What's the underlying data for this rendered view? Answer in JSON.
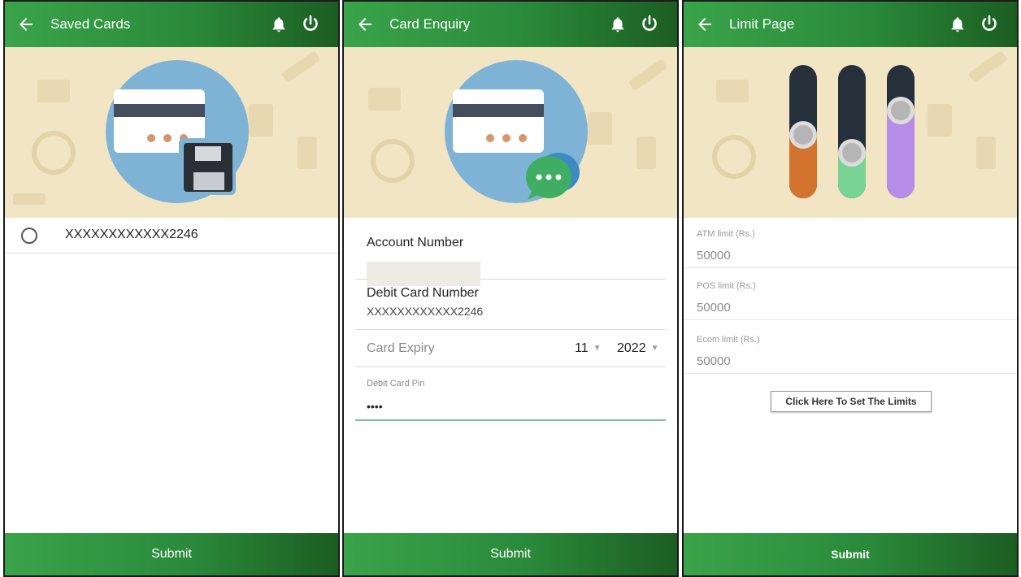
{
  "screens": {
    "saved_cards": {
      "title": "Saved Cards",
      "card_number": "XXXXXXXXXXXX2246",
      "submit_label": "Submit"
    },
    "card_enquiry": {
      "title": "Card Enquiry",
      "account_number_label": "Account Number",
      "debit_card_number_label": "Debit Card Number",
      "debit_card_number_value": "XXXXXXXXXXXX2246",
      "card_expiry_label": "Card Expiry",
      "expiry_month": "11",
      "expiry_year": "2022",
      "pin_label": "Debit Card Pin",
      "pin_value": "••••",
      "submit_label": "Submit"
    },
    "limit_page": {
      "title": "Limit Page",
      "atm_label": "ATM limit (Rs.)",
      "atm_value": "50000",
      "pos_label": "POS limit (Rs.)",
      "pos_value": "50000",
      "ecom_label": "Ecom limit (Rs.)",
      "ecom_value": "50000",
      "set_limits_label": "Click Here To Set The Limits",
      "submit_label": "Submit"
    }
  },
  "icons": {
    "back": "arrow-left-icon",
    "bell": "bell-icon",
    "power": "power-icon",
    "caret": "▼"
  },
  "colors": {
    "header_start": "#3aa44a",
    "header_end": "#1c5e22",
    "banner_bg": "#f1e5c4",
    "circle": "#7eb3d6",
    "slider_track": "#26303a",
    "slider_orange": "#d2742e",
    "slider_green": "#78d494",
    "slider_purple": "#b58de8"
  }
}
